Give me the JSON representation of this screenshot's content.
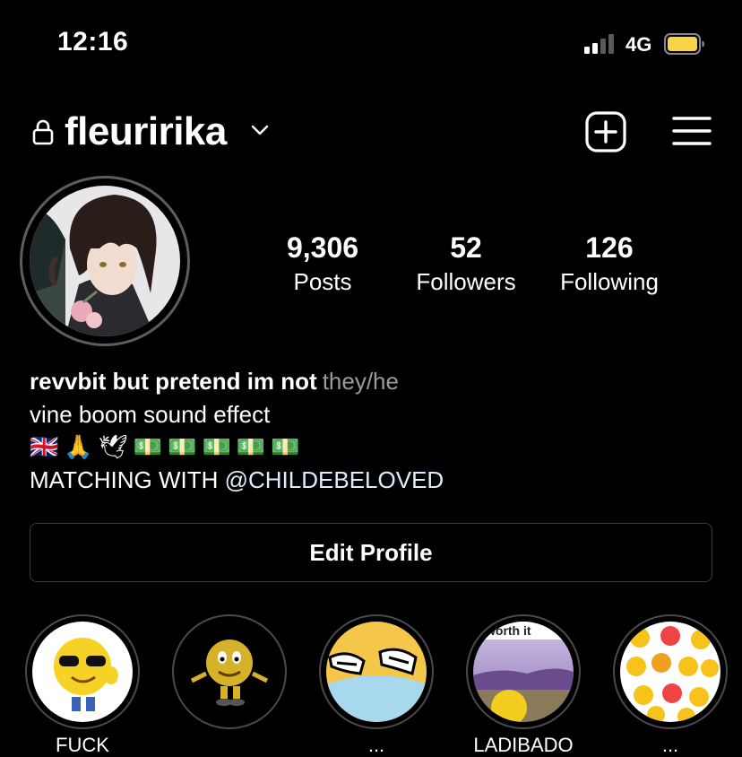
{
  "status_bar": {
    "time": "12:16",
    "network": "4G",
    "signal_icon": "cellular-signal-icon",
    "battery_icon": "battery-icon",
    "battery_color": "#f5d547"
  },
  "header": {
    "username": "fleuririka",
    "lock_icon": "lock-icon",
    "chevron_icon": "chevron-down-icon",
    "add_icon": "add-post-icon",
    "menu_icon": "hamburger-menu-icon"
  },
  "stats": {
    "posts": {
      "value": "9,306",
      "label": "Posts"
    },
    "followers": {
      "value": "52",
      "label": "Followers"
    },
    "following": {
      "value": "126",
      "label": "Following"
    }
  },
  "bio": {
    "name": "revvbit but pretend im not",
    "pronouns": "they/he",
    "line1": "vine boom sound effect",
    "emojis": [
      "🇬🇧",
      "🙏",
      "🕊",
      "💵",
      "💵",
      "💵",
      "💵",
      "💵"
    ],
    "line3_prefix": "MATCHING WITH ",
    "mention": "@CHILDEBELOVED"
  },
  "edit_profile_label": "Edit Profile",
  "highlights": [
    {
      "label": "FUCK",
      "cover": "sunglasses-emoji-thumbs-up"
    },
    {
      "label": "",
      "cover": "3d-smiley-shrug"
    },
    {
      "label": "...",
      "cover": "cartoon-hands"
    },
    {
      "label": "LADIBADO",
      "cover": "worth-it-meme"
    },
    {
      "label": "...",
      "cover": "emoji-collage"
    }
  ],
  "highlight4_caption": "worth it"
}
